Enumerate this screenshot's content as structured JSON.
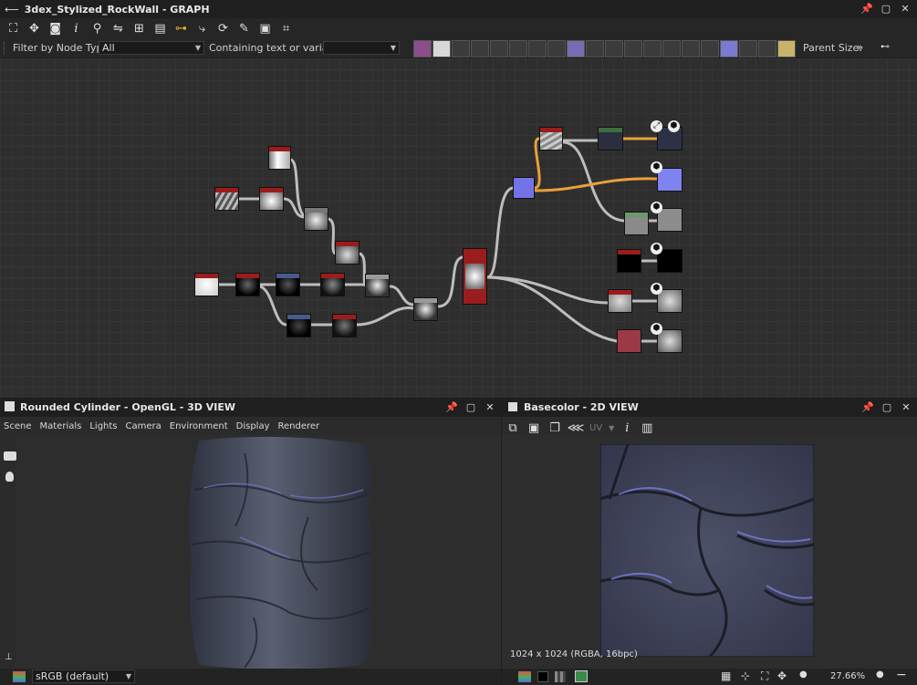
{
  "graph": {
    "title": "3dex_Stylized_RockWall - GRAPH",
    "filter_label": "Filter by Node Type",
    "filter_value": "All",
    "containing_label": "Containing text or variable",
    "containing_value": "",
    "parent_size_label": "Parent Size:",
    "more_label": "»",
    "toolbar_icons": [
      "frame-icon",
      "pan-icon",
      "camera-icon",
      "info-icon",
      "search-icon",
      "connect-icon",
      "hierarchy-icon",
      "layers-icon",
      "link-icon",
      "branch-icon",
      "cycle-icon",
      "wrench-icon",
      "screenshot-icon",
      "align-icon"
    ],
    "node_filters": [
      "#8a4f8a",
      "#d8d8d8",
      "#3b3b3b",
      "#3b3b3b",
      "#3b3b3b",
      "#3b3b3b",
      "#3b3b3b",
      "#3b3b3b",
      "#7a6bb0",
      "#3b3b3b",
      "#3b3b3b",
      "#3b3b3b",
      "#3b3b3b",
      "#3b3b3b",
      "#3b3b3b",
      "#3b3b3b",
      "#7a7ad0",
      "#3b3b3b",
      "#3b3b3b",
      "#c9b36a"
    ]
  },
  "view3d": {
    "title": "Rounded Cylinder - OpenGL - 3D VIEW",
    "menu": [
      "Scene",
      "Materials",
      "Lights",
      "Camera",
      "Environment",
      "Display",
      "Renderer"
    ],
    "colorspace": "sRGB (default)"
  },
  "view2d": {
    "title": "Basecolor - 2D VIEW",
    "uv_label": "UV",
    "info_text": "1024 x 1024 (RGBA, 16bpc)",
    "zoom": "27.66%"
  },
  "colors": {
    "accent_red": "#9b1c1c",
    "accent_blue": "#7373e8",
    "accent_green": "#6a9a6a",
    "wire_orange": "#e8a03a",
    "wire_grey": "#bdbdbd"
  }
}
